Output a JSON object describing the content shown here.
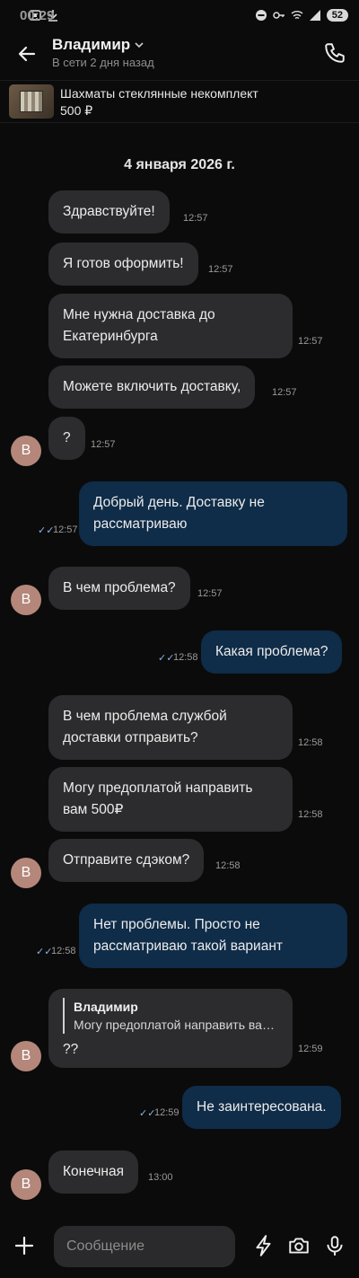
{
  "status_bar": {
    "time": "00:29",
    "battery": "52"
  },
  "header": {
    "name": "Владимир",
    "status": "В сети 2 дня назад"
  },
  "listing": {
    "title": "Шахматы стеклянные некомплект",
    "price": "500 ₽"
  },
  "date_separator": "4 января 2026 г.",
  "avatar_letter": "В",
  "messages": [
    {
      "dir": "in",
      "text": "Здравствуйте!",
      "time": "12:57"
    },
    {
      "dir": "in",
      "text": "Я готов оформить!",
      "time": "12:57"
    },
    {
      "dir": "in",
      "text": "Мне нужна доставка до Екатеринбурга",
      "time": "12:57"
    },
    {
      "dir": "in",
      "text": "Можете включить доставку,",
      "time": "12:57"
    },
    {
      "dir": "in",
      "text": "?",
      "time": "12:57"
    },
    {
      "dir": "out",
      "text": "Добрый день. Доставку не рассматриваю",
      "time": "12:57"
    },
    {
      "dir": "in",
      "text": "В чем проблема?",
      "time": "12:57"
    },
    {
      "dir": "out",
      "text": "Какая проблема?",
      "time": "12:58"
    },
    {
      "dir": "in",
      "text": "В чем проблема службой доставки отправить?",
      "time": "12:58"
    },
    {
      "dir": "in",
      "text": "Могу предоплатой направить вам 500₽",
      "time": "12:58"
    },
    {
      "dir": "in",
      "text": "Отправите сдэком?",
      "time": "12:58"
    },
    {
      "dir": "out",
      "text": "Нет проблемы. Просто не рассматриваю такой вариант",
      "time": "12:58"
    },
    {
      "dir": "in",
      "text": "??",
      "time": "12:59",
      "quote_author": "Владимир",
      "quote_text": "Могу предоплатой направить вам 500₽"
    },
    {
      "dir": "out",
      "text": "Не заинтересована.",
      "time": "12:59"
    },
    {
      "dir": "in",
      "text": "Конечная",
      "time": "13:00"
    }
  ],
  "composer": {
    "placeholder": "Сообщение"
  },
  "icons": [
    "back-arrow-icon",
    "chevron-down-icon",
    "phone-icon",
    "plus-icon",
    "lightning-icon",
    "camera-icon",
    "microphone-icon",
    "double-check-icon"
  ],
  "colors": {
    "background": "#0b0b0c",
    "incoming": "#2c2c2e",
    "outgoing": "#0f2c48",
    "read_ticks": "#8ab4e0",
    "avatar": "#b4877a"
  }
}
